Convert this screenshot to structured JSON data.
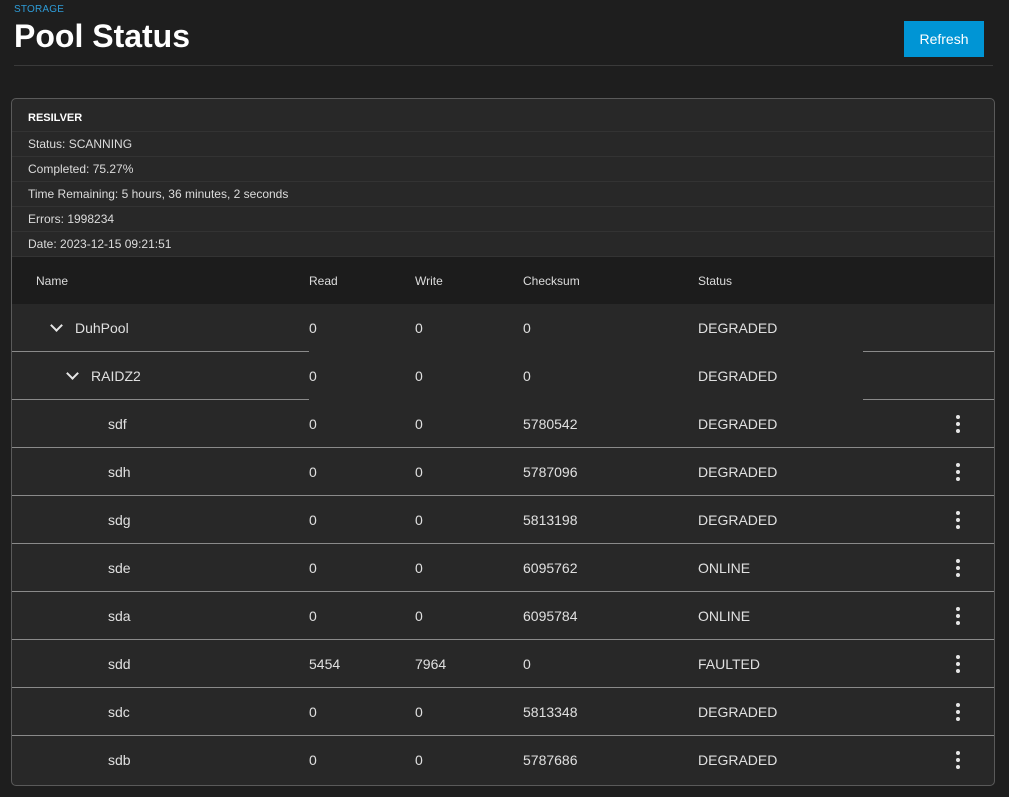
{
  "header": {
    "breadcrumb": "STORAGE",
    "title": "Pool Status",
    "refresh_label": "Refresh"
  },
  "resilver": {
    "title": "RESILVER",
    "status": "Status: SCANNING",
    "completed": "Completed: 75.27%",
    "time_remaining": "Time Remaining:  5 hours,  36 minutes,  2 seconds",
    "errors": "Errors: 1998234",
    "date": "Date: 2023-12-15 09:21:51"
  },
  "table": {
    "columns": [
      "Name",
      "Read",
      "Write",
      "Checksum",
      "Status"
    ],
    "rows": [
      {
        "name": "DuhPool",
        "read": "0",
        "write": "0",
        "checksum": "0",
        "status": "DEGRADED",
        "level": 0,
        "expandable": true
      },
      {
        "name": "RAIDZ2",
        "read": "0",
        "write": "0",
        "checksum": "0",
        "status": "DEGRADED",
        "level": 1,
        "expandable": true
      },
      {
        "name": "sdf",
        "read": "0",
        "write": "0",
        "checksum": "5780542",
        "status": "DEGRADED",
        "level": 2,
        "expandable": false
      },
      {
        "name": "sdh",
        "read": "0",
        "write": "0",
        "checksum": "5787096",
        "status": "DEGRADED",
        "level": 2,
        "expandable": false
      },
      {
        "name": "sdg",
        "read": "0",
        "write": "0",
        "checksum": "5813198",
        "status": "DEGRADED",
        "level": 2,
        "expandable": false
      },
      {
        "name": "sde",
        "read": "0",
        "write": "0",
        "checksum": "6095762",
        "status": "ONLINE",
        "level": 2,
        "expandable": false
      },
      {
        "name": "sda",
        "read": "0",
        "write": "0",
        "checksum": "6095784",
        "status": "ONLINE",
        "level": 2,
        "expandable": false
      },
      {
        "name": "sdd",
        "read": "5454",
        "write": "7964",
        "checksum": "0",
        "status": "FAULTED",
        "level": 2,
        "expandable": false
      },
      {
        "name": "sdc",
        "read": "0",
        "write": "0",
        "checksum": "5813348",
        "status": "DEGRADED",
        "level": 2,
        "expandable": false
      },
      {
        "name": "sdb",
        "read": "0",
        "write": "0",
        "checksum": "5787686",
        "status": "DEGRADED",
        "level": 2,
        "expandable": false
      }
    ]
  },
  "icons": {
    "expand": "chevron-down-icon",
    "row_menu": "more-vert-icon"
  },
  "colors": {
    "accent": "#0095d5",
    "breadcrumb": "#2e9bd6",
    "background": "#1e1e1e",
    "card": "#282828"
  }
}
